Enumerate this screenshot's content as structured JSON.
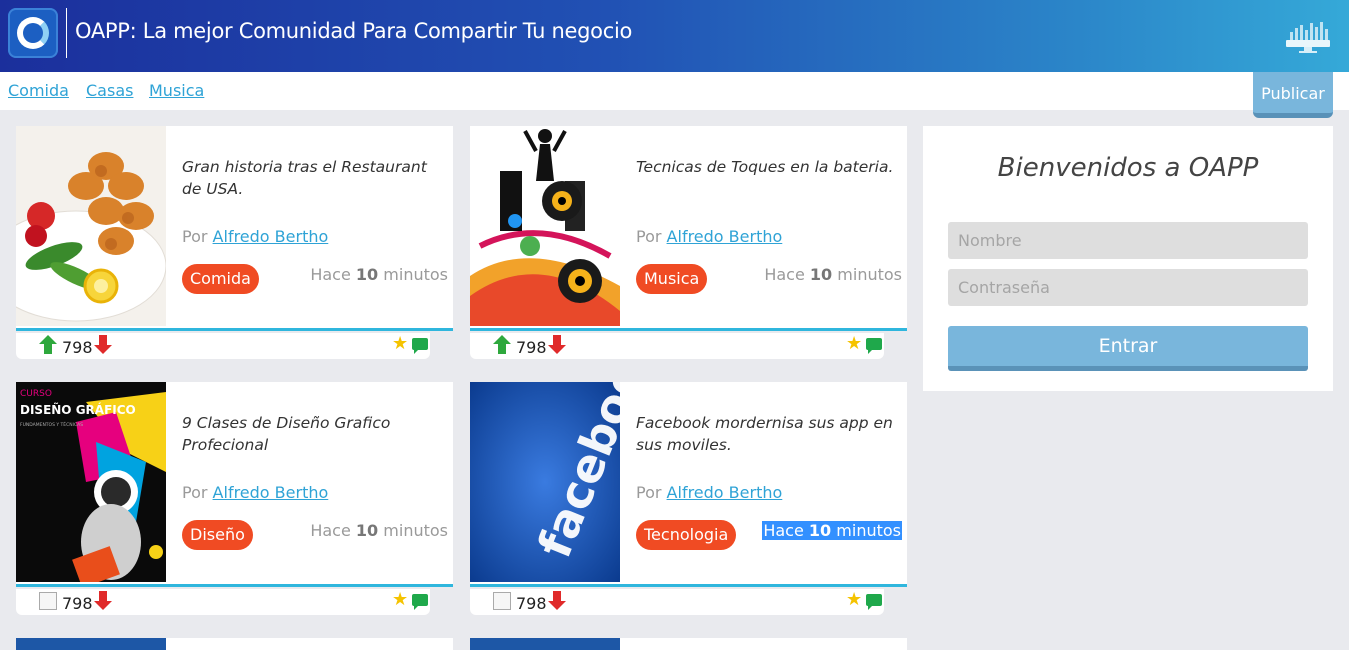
{
  "header": {
    "title": "OAPP: La mejor Comunidad Para Compartir Tu negocio"
  },
  "categories": [
    "Comida",
    "Casas",
    "Musica"
  ],
  "publish_label": "Publicar",
  "posts": [
    {
      "title": "Gran historia tras el Restaurant de USA.",
      "by": "Por",
      "author": "Alfredo Bertho",
      "tag": "Comida",
      "time_prefix": "Hace",
      "time_num": "10",
      "time_unit": "minutos",
      "votes": "798"
    },
    {
      "title": "Tecnicas de Toques en la bateria.",
      "by": "Por",
      "author": "Alfredo Bertho",
      "tag": "Musica",
      "time_prefix": "Hace",
      "time_num": "10",
      "time_unit": "minutos",
      "votes": "798"
    },
    {
      "title": "9 Clases de Diseño Grafico Profecional",
      "by": "Por",
      "author": "Alfredo Bertho",
      "tag": "Diseño",
      "time_prefix": "Hace",
      "time_num": "10",
      "time_unit": "minutos",
      "votes": "798",
      "thumb_text": [
        "CURSO",
        "DISEÑO GRÁFICO",
        "FUNDAMENTOS Y TÉCNICAS"
      ]
    },
    {
      "title": "Facebook mordernisa sus app en sus moviles.",
      "by": "Por",
      "author": "Alfredo Bertho",
      "tag": "Tecnologia",
      "time_prefix": "Hace",
      "time_num": "10",
      "time_unit": "minutos",
      "votes": "798",
      "thumb_text": [
        "facebook"
      ]
    }
  ],
  "login": {
    "welcome": "Bienvenidos a OAPP",
    "name_placeholder": "Nombre",
    "password_placeholder": "Contraseña",
    "submit_label": "Entrar"
  },
  "colors": {
    "header_start": "#1b2f9c",
    "header_end": "#35a9d8",
    "tag": "#f04b23",
    "link": "#2fa3d6",
    "button": "#79b6dc",
    "card_border": "#2fb6dd"
  }
}
